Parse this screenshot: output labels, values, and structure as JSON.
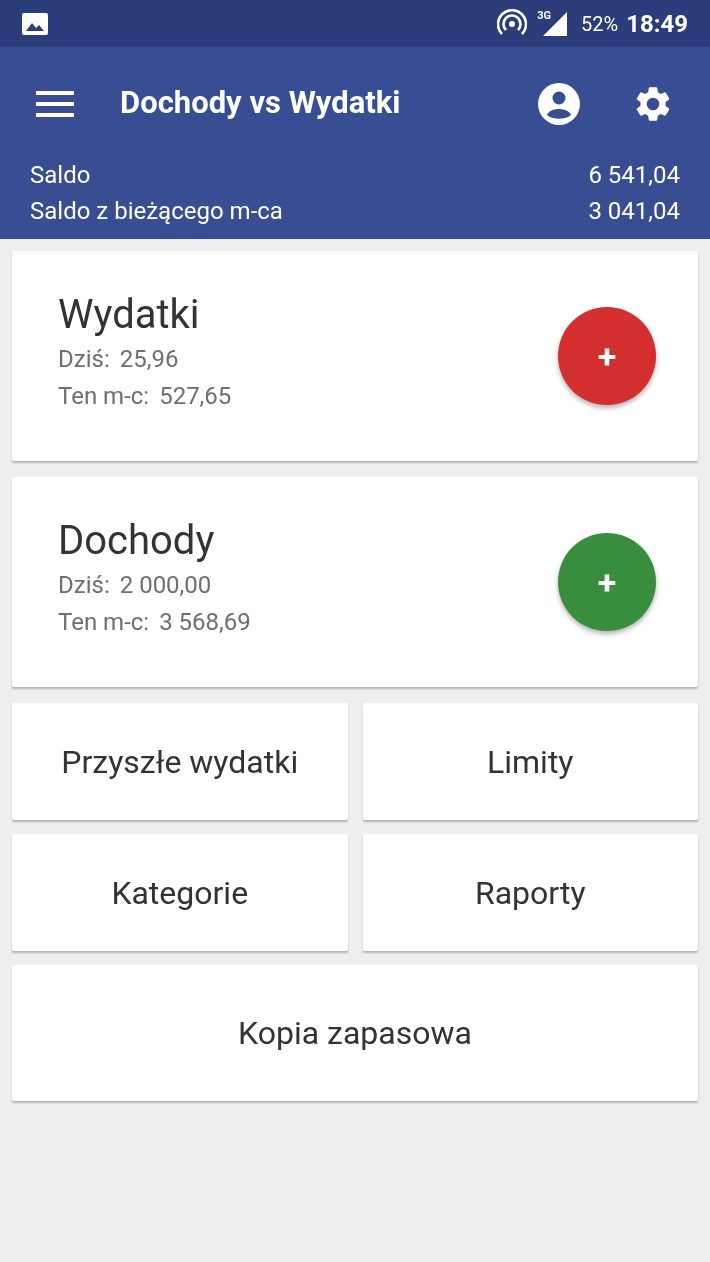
{
  "status_bar": {
    "network": "3G",
    "battery": "52%",
    "time": "18:49"
  },
  "app_bar": {
    "title": "Dochody vs Wydatki"
  },
  "balance": [
    {
      "label": "Saldo",
      "value": "6 541,04"
    },
    {
      "label": "Saldo z bieżącego m-ca",
      "value": "3 041,04"
    }
  ],
  "summary_cards": [
    {
      "kind": "expense",
      "title": "Wydatki",
      "rows": [
        {
          "label": "Dziś:",
          "value": "25,96"
        },
        {
          "label": "Ten m-c:",
          "value": "527,65"
        }
      ],
      "button": "+"
    },
    {
      "kind": "income",
      "title": "Dochody",
      "rows": [
        {
          "label": "Dziś:",
          "value": "2 000,00"
        },
        {
          "label": "Ten m-c:",
          "value": "3 568,69"
        }
      ],
      "button": "+"
    }
  ],
  "menu_buttons": [
    "Przyszłe wydatki",
    "Limity",
    "Kategorie",
    "Raporty",
    "Kopia zapasowa"
  ]
}
